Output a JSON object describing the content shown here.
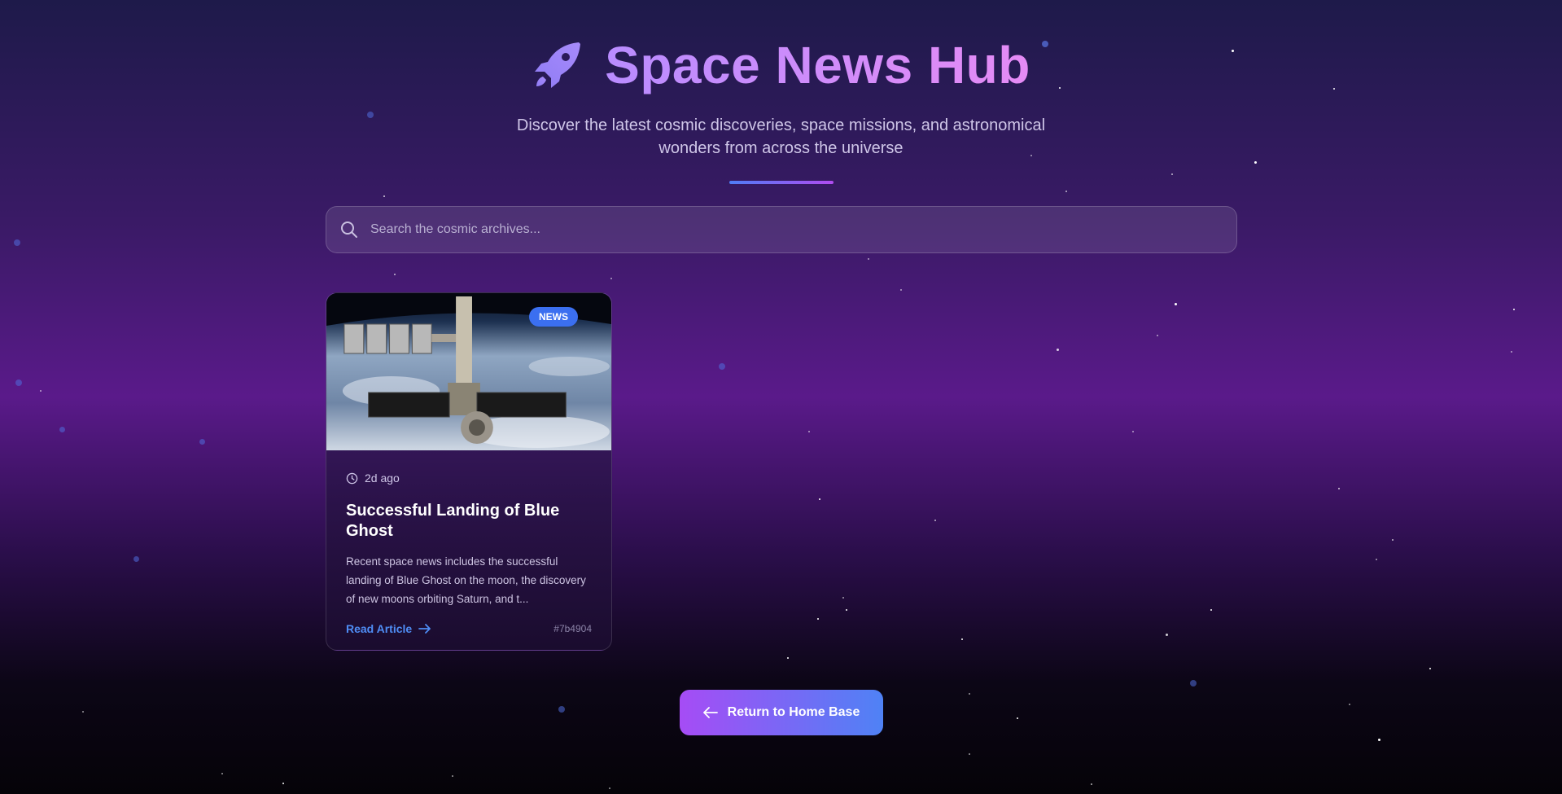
{
  "header": {
    "title": "Space News Hub",
    "subtitle": "Discover the latest cosmic discoveries, space missions, and astronomical wonders from across the universe",
    "logo_icon": "rocket-icon"
  },
  "search": {
    "placeholder": "Search the cosmic archives...",
    "value": "",
    "icon": "search-icon"
  },
  "articles": [
    {
      "badge": "NEWS",
      "time": "2d ago",
      "title": "Successful Landing of Blue Ghost",
      "description": "Recent space news includes the successful landing of Blue Ghost on the moon, the discovery of new moons orbiting Saturn, and t...",
      "link_label": "Read Article",
      "id": "#7b4904",
      "image_icon": "space-station-image"
    }
  ],
  "footer": {
    "home_button": "Return to Home Base"
  },
  "colors": {
    "accent_purple": "#a64cf5",
    "accent_blue": "#4f82f5",
    "badge_blue": "#3b6ff0",
    "link_blue": "#4f8df5",
    "title_gradient_start": "#b98cff",
    "title_gradient_end": "#e58bf5"
  }
}
